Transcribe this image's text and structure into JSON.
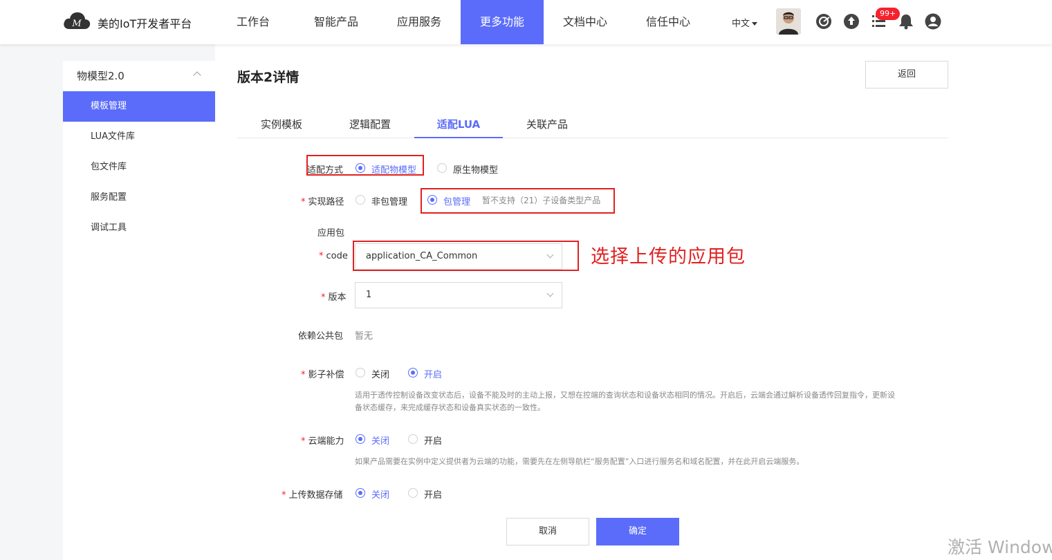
{
  "header": {
    "brand": "美的IoT开发者平台",
    "nav": [
      "工作台",
      "智能产品",
      "应用服务",
      "更多功能",
      "文档中心",
      "信任中心"
    ],
    "active_nav": "更多功能",
    "lang": "中文",
    "badge": "99+",
    "icons": [
      "avatar",
      "target-icon",
      "upload-icon",
      "list-icon",
      "bell-icon",
      "user-icon"
    ]
  },
  "sidebar": {
    "group": "物模型2.0",
    "items": [
      "模板管理",
      "LUA文件库",
      "包文件库",
      "服务配置",
      "调试工具"
    ],
    "active": "模板管理"
  },
  "page": {
    "title": "版本2详情",
    "back": "返回",
    "tabs": [
      "实例模板",
      "逻辑配置",
      "适配LUA",
      "关联产品"
    ],
    "active_tab": "适配LUA"
  },
  "form": {
    "adapt_mode": {
      "label": "适配方式",
      "options": [
        "适配物模型",
        "原生物模型"
      ],
      "selected": "适配物模型"
    },
    "impl_path": {
      "label": "实现路径",
      "options": [
        "非包管理",
        "包管理"
      ],
      "selected": "包管理",
      "note": "暂不支持（21）子设备类型产品"
    },
    "app_pkg_label": "应用包",
    "code": {
      "label": "code",
      "value": "application_CA_Common"
    },
    "version": {
      "label": "版本",
      "value": "1"
    },
    "dep_pkg": {
      "label": "依赖公共包",
      "value": "暂无"
    },
    "shadow": {
      "label": "影子补偿",
      "options": [
        "关闭",
        "开启"
      ],
      "selected": "开启",
      "hint_line1": "适用于透传控制设备改变状态后，设备不能及时的主动上报，又想在控端的查询状态和设备状态相同的情况。开启后，云端会通过解析设备透传回复指令，更新设",
      "hint_line2": "备状态缓存，来完成缓存状态和设备真实状态的一致性。"
    },
    "cloud": {
      "label": "云端能力",
      "options": [
        "关闭",
        "开启"
      ],
      "selected": "关闭",
      "hint": "如果产品需要在实例中定义提供者为云端的功能，需要先在左侧导航栏“服务配置”入口进行服务名和域名配置，并在此开启云端服务。"
    },
    "upload": {
      "label": "上传数据存储",
      "options": [
        "关闭",
        "开启"
      ],
      "selected": "关闭"
    },
    "cancel": "取消",
    "confirm": "确定"
  },
  "annotation": "选择上传的应用包",
  "watermark": "激活 Window",
  "colors": {
    "accent": "#5b6cfa",
    "annotation_red": "#e02020",
    "required": "#f5222d"
  }
}
